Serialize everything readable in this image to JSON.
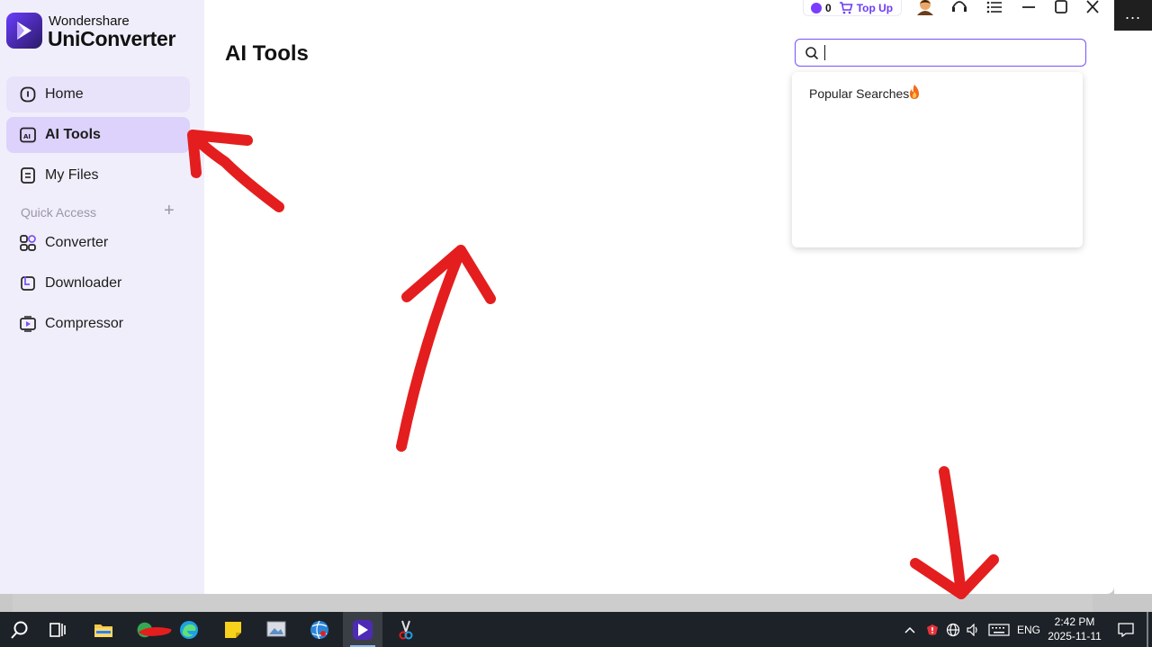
{
  "app": {
    "brand_top": "Wondershare",
    "brand_main": "UniConverter",
    "accent": "#7b52f6"
  },
  "topbar": {
    "coin_count": "0",
    "topup_label": "Top Up",
    "icons": [
      "gem-icon",
      "cart-icon",
      "avatar",
      "headset-icon",
      "menu-list-icon",
      "minimize-icon",
      "maximize-icon",
      "close-icon"
    ]
  },
  "sidebar": {
    "items": [
      {
        "label": "Home",
        "icon": "home-icon"
      },
      {
        "label": "AI Tools",
        "icon": "ai-icon",
        "active": true
      },
      {
        "label": "My Files",
        "icon": "file-icon"
      }
    ],
    "quick_access_label": "Quick Access",
    "quick_items": [
      {
        "label": "Converter",
        "icon": "converter-icon"
      },
      {
        "label": "Downloader",
        "icon": "downloader-icon"
      },
      {
        "label": "Compressor",
        "icon": "compressor-icon"
      }
    ]
  },
  "main": {
    "title": "AI Tools",
    "search": {
      "value": "",
      "placeholder": ""
    },
    "popular_label": "Popular Searches"
  },
  "desktop": {
    "more_label": "..."
  },
  "taskbar": {
    "language": "ENG",
    "time": "2:42 PM",
    "date": "2025-11-11"
  }
}
